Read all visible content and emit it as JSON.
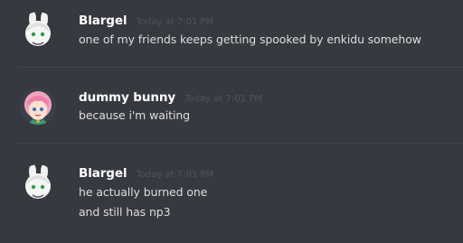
{
  "messages": [
    {
      "username": "Blargel",
      "timestamp": "Today at 7:01 PM",
      "lines": [
        "one of my friends keeps getting spooked by enkidu somehow"
      ],
      "avatar": "white-bunny-avatar"
    },
    {
      "username": "dummy bunny",
      "timestamp": "Today at 7:01 PM",
      "lines": [
        "because i'm waiting"
      ],
      "avatar": "pink-hair-girl-avatar"
    },
    {
      "username": "Blargel",
      "timestamp": "Today at 7:01 PM",
      "lines": [
        "he actually burned one",
        "and still has np3"
      ],
      "avatar": "white-bunny-avatar"
    }
  ],
  "colors": {
    "background": "#36393f",
    "username": "#ffffff",
    "message_text": "#dcddde",
    "timestamp": "#4f545c",
    "divider": "#40444b"
  }
}
